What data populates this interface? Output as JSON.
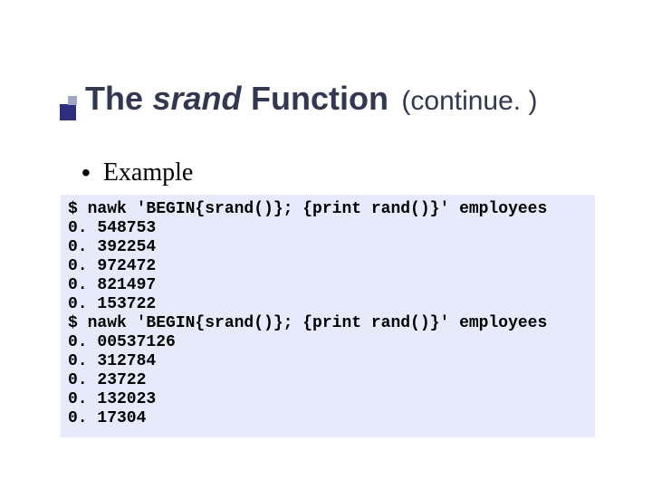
{
  "title": {
    "word_the": "The",
    "word_srand": "srand",
    "word_function": "Function",
    "word_continue": "(continue. )"
  },
  "bullet": {
    "dot": "•",
    "label": "Example"
  },
  "code": {
    "lines": [
      "$ nawk 'BEGIN{srand()}; {print rand()}' employees",
      "0. 548753",
      "0. 392254",
      "0. 972472",
      "0. 821497",
      "0. 153722",
      "$ nawk 'BEGIN{srand()}; {print rand()}' employees",
      "0. 00537126",
      "0. 312784",
      "0. 23722",
      "0. 132023",
      "0. 17304"
    ]
  }
}
